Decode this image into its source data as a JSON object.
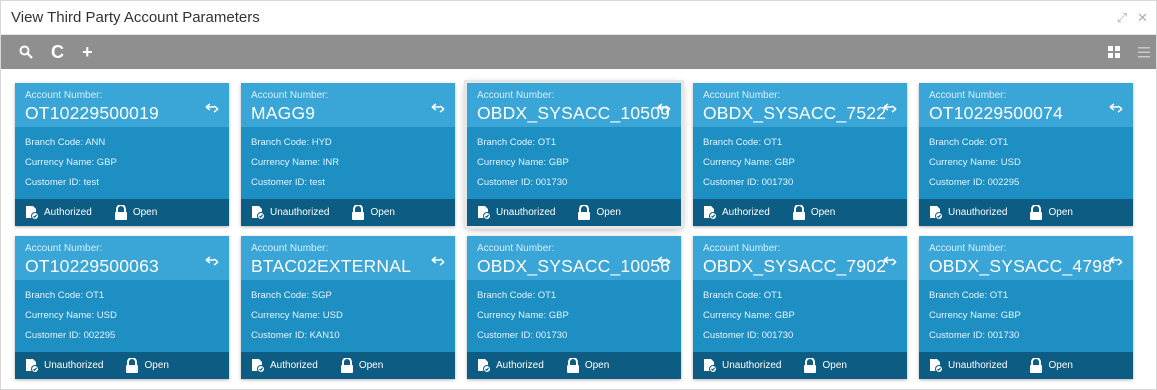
{
  "window": {
    "title": "View Third Party Account Parameters"
  },
  "cards": [
    {
      "account_label": "Account Number:",
      "account_number": "OT10229500019",
      "branch": "Branch Code: ANN",
      "currency": "Currency Name: GBP",
      "customer": "Customer ID: test",
      "auth_status": "Authorized",
      "record_status": "Open"
    },
    {
      "account_label": "Account Number:",
      "account_number": "MAGG9",
      "branch": "Branch Code: HYD",
      "currency": "Currency Name: INR",
      "customer": "Customer ID: test",
      "auth_status": "Unauthorized",
      "record_status": "Open"
    },
    {
      "account_label": "Account Number:",
      "account_number": "OBDX_SYSACC_10509",
      "branch": "Branch Code: OT1",
      "currency": "Currency Name: GBP",
      "customer": "Customer ID: 001730",
      "auth_status": "Unauthorized",
      "record_status": "Open"
    },
    {
      "account_label": "Account Number:",
      "account_number": "OBDX_SYSACC_7522",
      "branch": "Branch Code: OT1",
      "currency": "Currency Name: GBP",
      "customer": "Customer ID: 001730",
      "auth_status": "Authorized",
      "record_status": "Open"
    },
    {
      "account_label": "Account Number:",
      "account_number": "OT10229500074",
      "branch": "Branch Code: OT1",
      "currency": "Currency Name: USD",
      "customer": "Customer ID: 002295",
      "auth_status": "Unauthorized",
      "record_status": "Open"
    },
    {
      "account_label": "Account Number:",
      "account_number": "OT10229500063",
      "branch": "Branch Code: OT1",
      "currency": "Currency Name: USD",
      "customer": "Customer ID: 002295",
      "auth_status": "Unauthorized",
      "record_status": "Open"
    },
    {
      "account_label": "Account Number:",
      "account_number": "BTAC02EXTERNAL",
      "branch": "Branch Code: SGP",
      "currency": "Currency Name: USD",
      "customer": "Customer ID: KAN10",
      "auth_status": "Authorized",
      "record_status": "Open"
    },
    {
      "account_label": "Account Number:",
      "account_number": "OBDX_SYSACC_10056",
      "branch": "Branch Code: OT1",
      "currency": "Currency Name: GBP",
      "customer": "Customer ID: 001730",
      "auth_status": "Authorized",
      "record_status": "Open"
    },
    {
      "account_label": "Account Number:",
      "account_number": "OBDX_SYSACC_7902",
      "branch": "Branch Code: OT1",
      "currency": "Currency Name: GBP",
      "customer": "Customer ID: 001730",
      "auth_status": "Unauthorized",
      "record_status": "Open"
    },
    {
      "account_label": "Account Number:",
      "account_number": "OBDX_SYSACC_4798",
      "branch": "Branch Code: OT1",
      "currency": "Currency Name: GBP",
      "customer": "Customer ID: 001730",
      "auth_status": "Unauthorized",
      "record_status": "Open"
    }
  ],
  "colors": {
    "card": "#1e8fc2",
    "card_head": "#3aa6d8",
    "card_foot": "#0d5c84",
    "toolbar": "#8f8f8f"
  }
}
